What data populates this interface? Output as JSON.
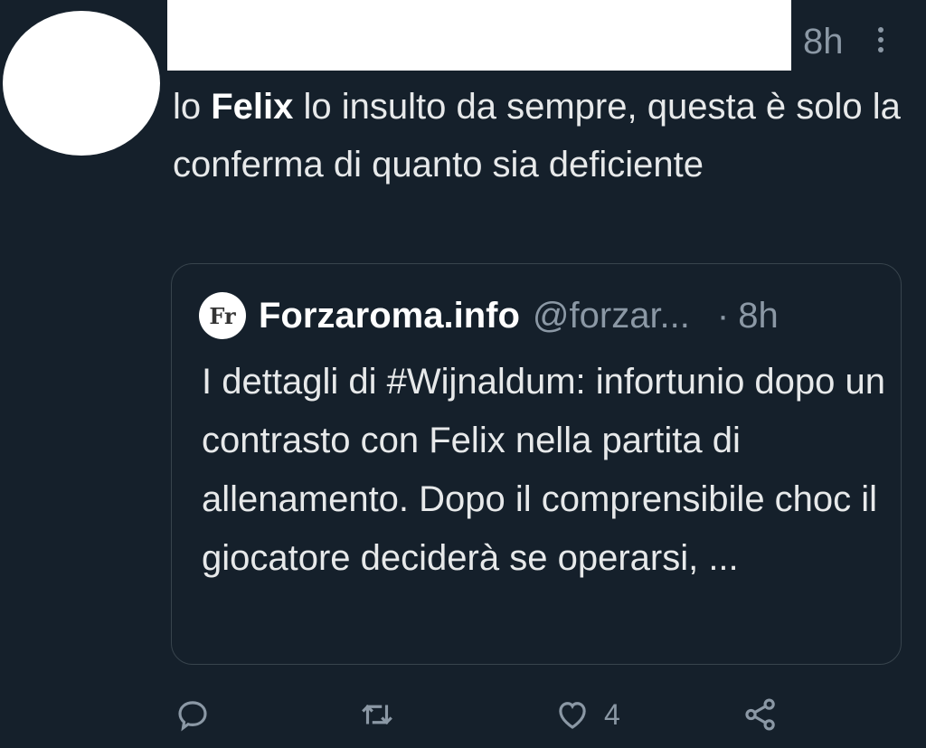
{
  "tweet": {
    "time": "8h",
    "text_before": "lo ",
    "text_bold": "Felix",
    "text_after": " lo insulto da sempre, questa è solo la conferma di quanto sia deficiente"
  },
  "quoted_tweet": {
    "avatar_text": "Fr",
    "name": "Forzaroma.info",
    "handle": "@forzar...",
    "separator": "·",
    "time": "8h",
    "text": "I dettagli di #Wijnaldum: infortunio dopo un contrasto con Felix nella partita di allenamento. Dopo il comprensibile choc il giocatore deciderà se operarsi, ..."
  },
  "actions": {
    "reply_icon": "reply-icon",
    "retweet_icon": "retweet-icon",
    "like_icon": "heart-icon",
    "like_count": "4",
    "share_icon": "share-icon"
  },
  "colors": {
    "background": "#15202b",
    "secondary_text": "#8b98a5",
    "primary_text": "#e7e9ea",
    "border": "#38444d"
  }
}
